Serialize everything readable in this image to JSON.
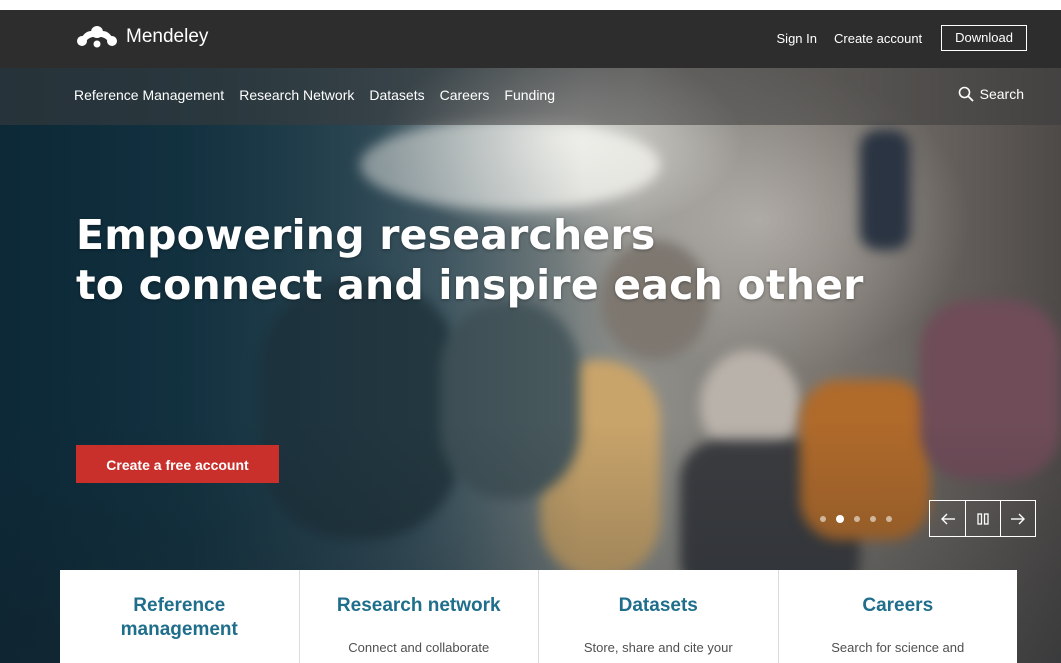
{
  "brand": {
    "name": "Mendeley"
  },
  "top_links": {
    "sign_in": "Sign In",
    "create_account": "Create account",
    "download": "Download"
  },
  "nav": {
    "items": [
      {
        "label": "Reference Management"
      },
      {
        "label": "Research Network"
      },
      {
        "label": "Datasets"
      },
      {
        "label": "Careers"
      },
      {
        "label": "Funding"
      }
    ],
    "search_label": "Search"
  },
  "hero": {
    "headline_line1": "Empowering researchers",
    "headline_line2": "to connect and inspire each other",
    "cta_label": "Create a free account",
    "carousel": {
      "slide_count": 5,
      "active_slide": 2
    }
  },
  "cards": [
    {
      "title": "Reference management",
      "description": ""
    },
    {
      "title": "Research network",
      "description": "Connect and collaborate"
    },
    {
      "title": "Datasets",
      "description": "Store, share and cite your"
    },
    {
      "title": "Careers",
      "description": "Search for science and"
    }
  ],
  "colors": {
    "accent_red": "#c9302c",
    "card_title_blue": "#1f6e8c",
    "topbar_bg": "#2d2d2d"
  },
  "icons": {
    "logo": "mendeley-logo-icon",
    "search": "search-icon",
    "prev": "arrow-left-icon",
    "pause": "pause-icon",
    "next": "arrow-right-icon"
  }
}
